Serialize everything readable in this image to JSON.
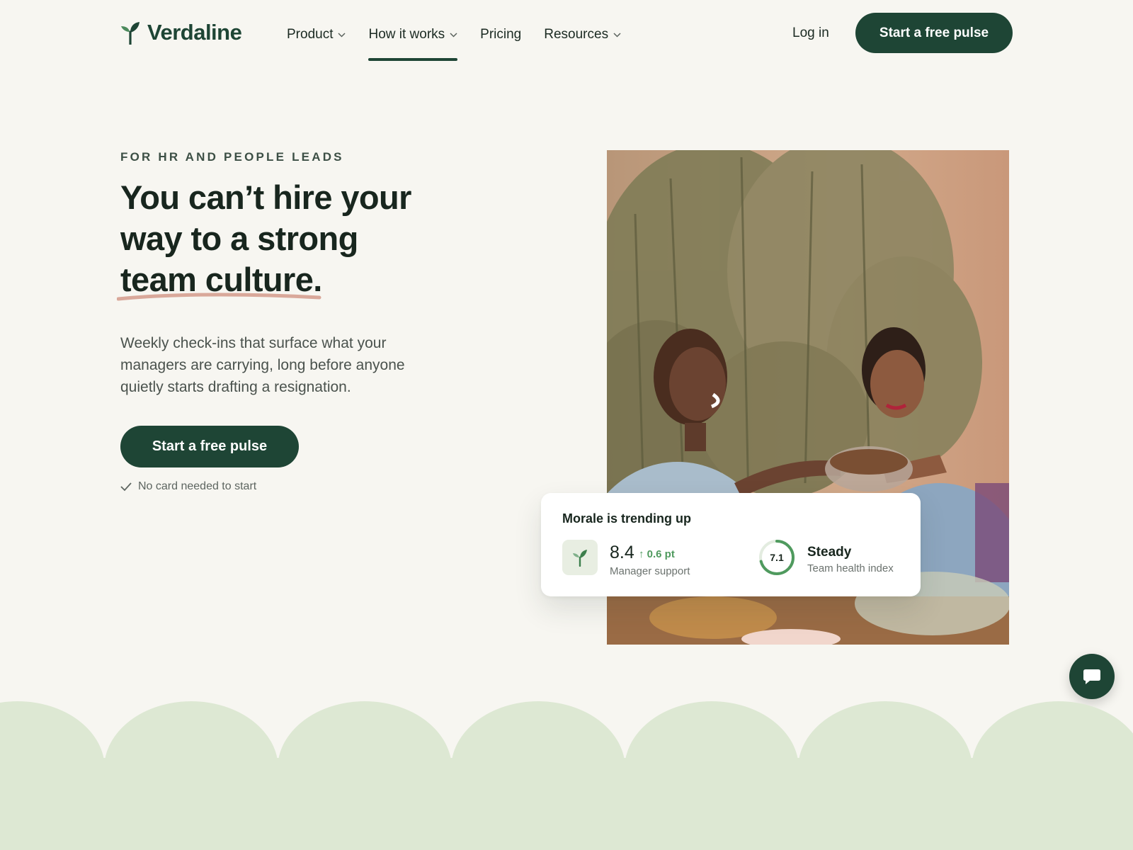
{
  "brand": {
    "name": "Verdaline",
    "color": "#1e4535"
  },
  "nav": {
    "items": [
      {
        "label": "Product",
        "has_dropdown": true,
        "active": false
      },
      {
        "label": "How it works",
        "has_dropdown": true,
        "active": true
      },
      {
        "label": "Pricing",
        "has_dropdown": false,
        "active": false
      },
      {
        "label": "Resources",
        "has_dropdown": true,
        "active": false
      }
    ],
    "login_label": "Log in",
    "cta_label": "Start a free pulse"
  },
  "hero": {
    "eyebrow": "FOR HR AND PEOPLE LEADS",
    "headline_lines": [
      "You can’t hire your",
      "way to a strong",
      "team culture."
    ],
    "lede": "Weekly check-ins that surface what your managers are carrying, long before anyone quietly starts drafting a resignation.",
    "cta_label": "Start a free pulse",
    "note": "No card needed to start"
  },
  "stats_card": {
    "title": "Morale is trending up",
    "metric": {
      "value": "8.4",
      "delta": "↑ 0.6 pt",
      "label": "Manager support",
      "icon": "sprout-icon"
    },
    "health": {
      "value": "7.1",
      "score": 7.1,
      "max": 10,
      "status": "Steady",
      "label": "Team health index"
    }
  },
  "chat": {
    "icon": "chat-bubble-icon"
  },
  "colors": {
    "background": "#f7f6f1",
    "accent": "#1e4535",
    "underline": "#d9a89a",
    "positive": "#4f9a5e",
    "scallop": "#dde8d3"
  }
}
